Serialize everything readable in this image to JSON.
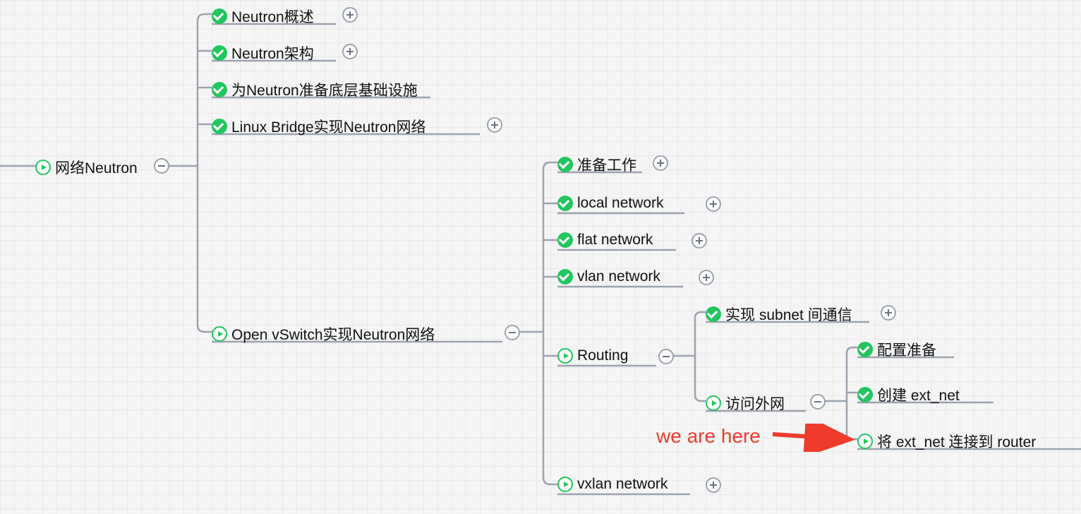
{
  "root": {
    "label": "网络Neutron",
    "icon": "play",
    "toggle": "minus"
  },
  "level2": [
    {
      "label": "Neutron概述",
      "icon": "check",
      "toggle": "plus"
    },
    {
      "label": "Neutron架构",
      "icon": "check",
      "toggle": "plus"
    },
    {
      "label": "为Neutron准备底层基础设施",
      "icon": "check",
      "toggle": null
    },
    {
      "label": "Linux Bridge实现Neutron网络",
      "icon": "check",
      "toggle": "plus"
    },
    {
      "label": "Open vSwitch实现Neutron网络",
      "icon": "play",
      "toggle": "minus"
    }
  ],
  "level3": [
    {
      "label": "准备工作",
      "icon": "check",
      "toggle": "plus"
    },
    {
      "label": "local network",
      "icon": "check",
      "toggle": "plus"
    },
    {
      "label": "flat network",
      "icon": "check",
      "toggle": "plus"
    },
    {
      "label": "vlan network",
      "icon": "check",
      "toggle": "plus"
    },
    {
      "label": "Routing",
      "icon": "play",
      "toggle": "minus"
    },
    {
      "label": "vxlan network",
      "icon": "play",
      "toggle": "plus"
    }
  ],
  "level4": [
    {
      "label": "实现 subnet 间通信",
      "icon": "check",
      "toggle": "plus"
    },
    {
      "label": "访问外网",
      "icon": "play",
      "toggle": "minus"
    }
  ],
  "level5": [
    {
      "label": "配置准备",
      "icon": "check",
      "toggle": null
    },
    {
      "label": "创建 ext_net",
      "icon": "check",
      "toggle": null
    },
    {
      "label": "将 ext_net 连接到 router",
      "icon": "play",
      "toggle": null
    }
  ],
  "annotation": "we are here"
}
